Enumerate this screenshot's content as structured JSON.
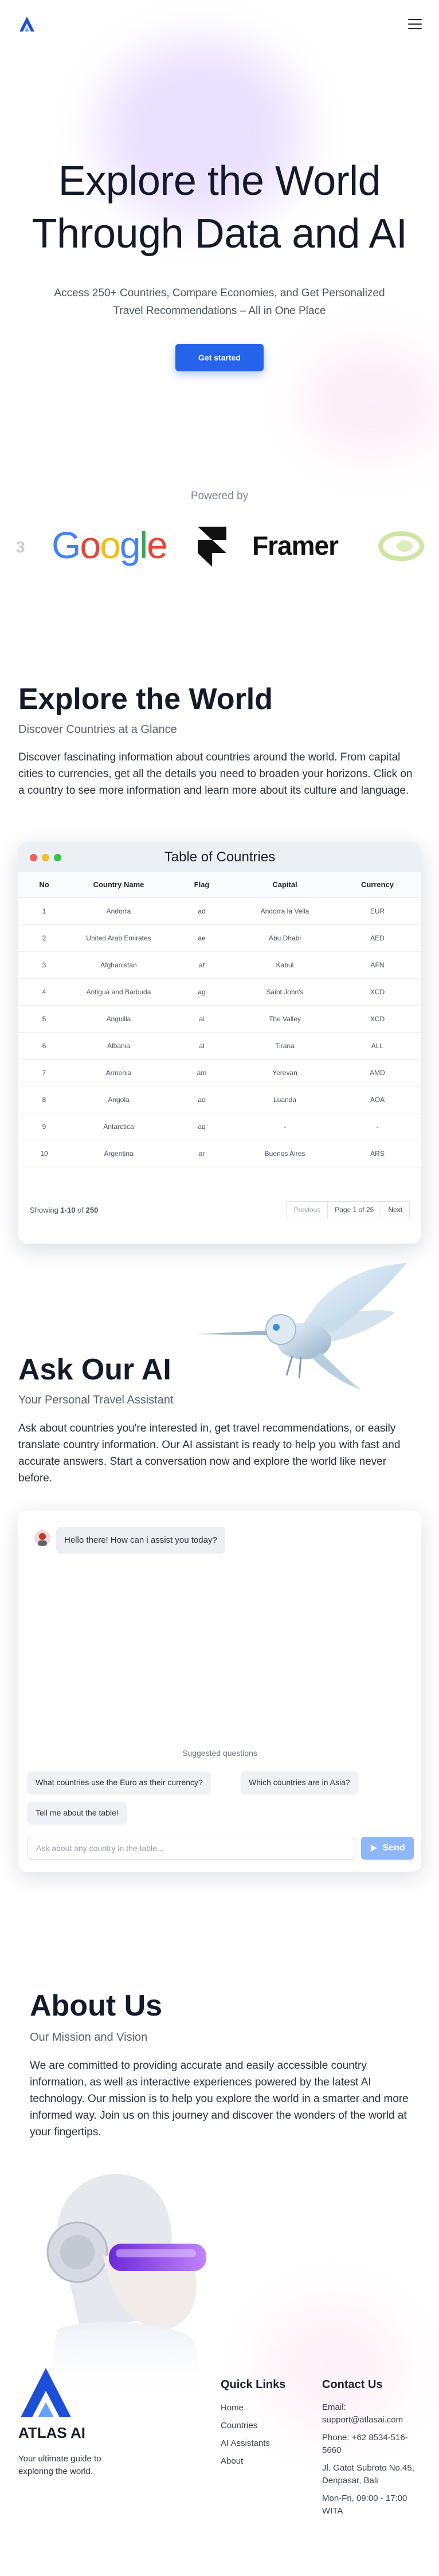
{
  "header": {
    "logo_icon": "atlas-triangle-logo",
    "menu_icon": "hamburger-menu-icon"
  },
  "hero": {
    "title_line1": "Explore the World",
    "title_line2": "Through Data and AI",
    "subtitle": "Access 250+ Countries, Compare Economies, and Get Personalized Travel Recommendations – All in One Place",
    "cta_label": "Get started"
  },
  "powered_by": {
    "label": "Powered by",
    "logos": [
      "Google",
      "Framer"
    ]
  },
  "explore": {
    "title": "Explore the World",
    "subtitle": "Discover Countries at a Glance",
    "body": "Discover fascinating information about countries around the world. From capital cities to currencies, get all the details you need to broaden your horizons. Click on a country to see more information and learn more about its culture and language."
  },
  "countries_table": {
    "title": "Table of Countries",
    "columns": [
      "No",
      "Country Name",
      "Flag",
      "Capital",
      "Currency"
    ],
    "rows": [
      [
        "1",
        "Andorra",
        "ad",
        "Andorra la Vella",
        "EUR"
      ],
      [
        "2",
        "United Arab Emirates",
        "ae",
        "Abu Dhabi",
        "AED"
      ],
      [
        "3",
        "Afghanistan",
        "af",
        "Kabul",
        "AFN"
      ],
      [
        "4",
        "Antigua and Barbuda",
        "ag",
        "Saint John's",
        "XCD"
      ],
      [
        "5",
        "Anguilla",
        "ai",
        "The Valley",
        "XCD"
      ],
      [
        "6",
        "Albania",
        "al",
        "Tirana",
        "ALL"
      ],
      [
        "7",
        "Armenia",
        "am",
        "Yerevan",
        "AMD"
      ],
      [
        "8",
        "Angola",
        "ao",
        "Luanda",
        "AOA"
      ],
      [
        "9",
        "Antarctica",
        "aq",
        "-",
        "-"
      ],
      [
        "10",
        "Argentina",
        "ar",
        "Buenos Aires",
        "ARS"
      ]
    ],
    "showing_prefix": "Showing",
    "showing_range": "1-10",
    "showing_of": "of",
    "showing_total": "250",
    "prev_label": "Previous",
    "page_label": "Page 1 of 25",
    "next_label": "Next"
  },
  "ask_ai": {
    "title": "Ask Our AI",
    "subtitle": "Your Personal Travel Assistant",
    "body": "Ask about countries you're interested in, get travel recommendations, or easily translate country information. Our AI assistant is ready to help you with fast and accurate answers. Start a conversation now and explore the world like never before."
  },
  "chat": {
    "greeting": "Hello there! How can i assist you today?",
    "suggested_title": "Suggested questions",
    "suggestions": [
      "What countries use the Euro as their currency?",
      "Which countries are in Asia?",
      "Tell me about the table!"
    ],
    "input_placeholder": "Ask about any country in the table...",
    "send_label": "Send"
  },
  "about": {
    "title": "About Us",
    "subtitle": "Our Mission and Vision",
    "body": "We are committed to providing accurate and easily accessible country information, as well as interactive experiences powered by the latest AI technology. Our mission is to help you explore the world in a smarter and more informed way. Join us on this journey and discover the wonders of the world at your fingertips."
  },
  "footer": {
    "brand": "ATLAS AI",
    "tagline": "Your ultimate guide to exploring the world.",
    "quick_links_title": "Quick Links",
    "links": [
      "Home",
      "Countries",
      "AI Assistants",
      "About"
    ],
    "contact_title": "Contact Us",
    "email": "Email: support@atlasai.com",
    "phone": "Phone: +62 8534-516-5660",
    "address": "Jl. Gatot Subroto No.45, Denpasar, Bali",
    "hours": "Mon-Fri, 09:00 - 17:00 WITA"
  },
  "colors": {
    "accent": "#2563eb",
    "send_disabled": "#8fb6f5",
    "dot_red": "#f25f57",
    "dot_yellow": "#f6bd2f",
    "dot_green": "#2dc840"
  }
}
